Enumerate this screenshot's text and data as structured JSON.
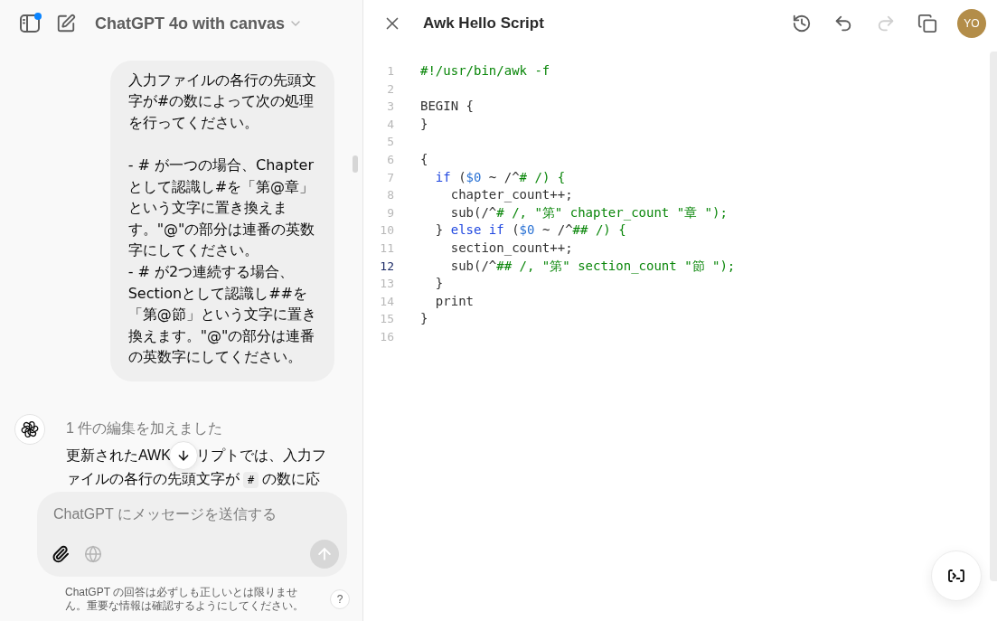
{
  "chat": {
    "header": {
      "title": "ChatGPT 4o with canvas",
      "sidebar_notification": true
    },
    "user_message": {
      "text": "入力ファイルの各行の先頭文字が#の数によって次の処理を行ってください。\n\n- # が一つの場合、Chapterとして認識し#を「第@章」という文字に置き換えます。\"@\"の部分は連番の英数字にしてください。\n- # が2つ連続する場合、Sectionとして認識し##を「第@節」という文字に置き換えます。\"@\"の部分は連番の英数字にしてください。"
    },
    "assistant_message": {
      "status": "1 件の編集を加えました",
      "parts": [
        {
          "kind": "text",
          "text": "更新されたAWK"
        },
        {
          "kind": "scroll_down_button"
        },
        {
          "kind": "text",
          "text": "リプトでは、入力ファイルの各行の先頭文字が"
        },
        {
          "kind": "code",
          "text": "#"
        },
        {
          "kind": "text",
          "text": "の数に応"
        }
      ]
    },
    "composer": {
      "placeholder": "ChatGPT にメッセージを送信する",
      "tools": [
        {
          "kind": "attach",
          "disabled": false
        },
        {
          "kind": "web",
          "disabled": true
        }
      ],
      "send_disabled": true
    },
    "disclaimer": "ChatGPT の回答は必ずしも正しいとは限りません。重要な情報は確認するようにしてください。",
    "help_label": "?"
  },
  "canvas": {
    "title": "Awk Hello Script",
    "actions": [
      {
        "kind": "history",
        "disabled": false
      },
      {
        "kind": "undo",
        "disabled": false
      },
      {
        "kind": "redo",
        "disabled": true
      },
      {
        "kind": "copy",
        "disabled": false
      }
    ],
    "avatar": "YO",
    "editor": {
      "lines": [
        {
          "number": "1",
          "active": false,
          "tokens": [
            {
              "kind": "comment",
              "text": "#!/usr/bin/awk -f"
            }
          ]
        },
        {
          "number": "2",
          "active": false
        },
        {
          "number": "3",
          "active": false,
          "tokens": [
            {
              "kind": "plain",
              "text": "BEGIN {"
            }
          ]
        },
        {
          "number": "4",
          "active": false,
          "tokens": [
            {
              "kind": "plain",
              "text": "}"
            }
          ]
        },
        {
          "number": "5",
          "active": false
        },
        {
          "number": "6",
          "active": false,
          "tokens": [
            {
              "kind": "plain",
              "text": "{"
            }
          ]
        },
        {
          "number": "7",
          "active": false,
          "tokens": [
            {
              "kind": "keyword",
              "text": "  if"
            },
            {
              "kind": "plain",
              "text": " ("
            },
            {
              "kind": "variable",
              "text": "$0"
            },
            {
              "kind": "plain",
              "text": " ~ /^"
            },
            {
              "kind": "comment",
              "text": "# /) {"
            }
          ]
        },
        {
          "number": "8",
          "active": false,
          "tokens": [
            {
              "kind": "plain",
              "text": "    chapter_count++;"
            }
          ]
        },
        {
          "number": "9",
          "active": false,
          "tokens": [
            {
              "kind": "plain",
              "text": "    sub(/^"
            },
            {
              "kind": "comment",
              "text": "# /, \"第\" chapter_count \"章 \");"
            }
          ]
        },
        {
          "number": "10",
          "active": false,
          "tokens": [
            {
              "kind": "plain",
              "text": "  } "
            },
            {
              "kind": "keyword",
              "text": "else if"
            },
            {
              "kind": "plain",
              "text": " ("
            },
            {
              "kind": "variable",
              "text": "$0"
            },
            {
              "kind": "plain",
              "text": " ~ /^"
            },
            {
              "kind": "comment",
              "text": "## /) {"
            }
          ]
        },
        {
          "number": "11",
          "active": false,
          "tokens": [
            {
              "kind": "plain",
              "text": "    section_count++;"
            }
          ]
        },
        {
          "number": "12",
          "active": true,
          "tokens": [
            {
              "kind": "plain",
              "text": "    sub(/^"
            },
            {
              "kind": "comment",
              "text": "## /, \"第\" section_count \"節 \");"
            }
          ]
        },
        {
          "number": "13",
          "active": false,
          "tokens": [
            {
              "kind": "plain",
              "text": "  }"
            }
          ]
        },
        {
          "number": "14",
          "active": false,
          "tokens": [
            {
              "kind": "plain",
              "text": "  print"
            }
          ]
        },
        {
          "number": "15",
          "active": false,
          "tokens": [
            {
              "kind": "plain",
              "text": "}"
            }
          ]
        },
        {
          "number": "16",
          "active": false
        }
      ]
    }
  }
}
